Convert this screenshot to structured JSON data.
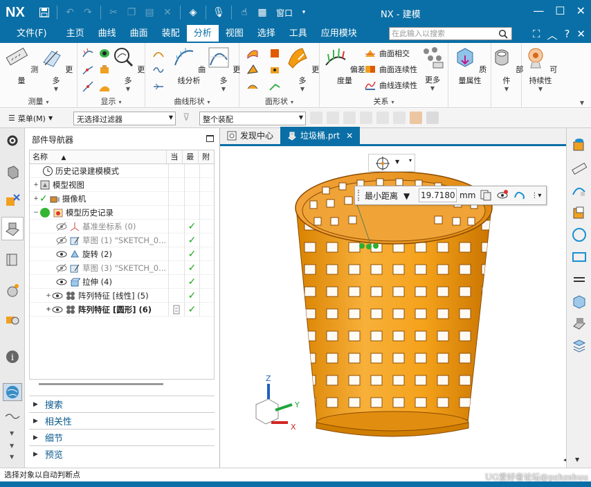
{
  "app": {
    "logo": "NX",
    "title": "NX - 建模",
    "window_menu": "窗口"
  },
  "menubar": {
    "file": "文件(F)",
    "tabs": [
      "主页",
      "曲线",
      "曲面",
      "装配",
      "分析",
      "视图",
      "选择",
      "工具",
      "应用模块"
    ],
    "active_tab": "分析",
    "search_placeholder": "在此输入以搜索"
  },
  "ribbon": {
    "measure_group": {
      "label": "测量",
      "buttons": [
        "测量",
        "更多"
      ]
    },
    "display_group": {
      "label": "显示",
      "buttons": [
        "更多"
      ]
    },
    "curve_shape_group": {
      "label": "曲线形状",
      "buttons": [
        "曲线分析",
        "更多"
      ]
    },
    "face_shape_group": {
      "label": "面形状",
      "buttons": [
        "更多"
      ]
    },
    "relation_group": {
      "label": "关系",
      "big": "偏差度量",
      "small": [
        "曲面相交",
        "曲面连续性",
        "曲线连续性"
      ],
      "more": "更多"
    },
    "mass": "质量属性",
    "part": "部件",
    "sustain": "可持续性"
  },
  "toolbar2": {
    "menu": "菜单(M)",
    "filter": "无选择过滤器",
    "assembly": "整个装配"
  },
  "navigator": {
    "title": "部件导航器",
    "columns": [
      "名称",
      "当",
      "最",
      "附"
    ],
    "rows": [
      {
        "label": "历史记录建模模式",
        "check": false
      },
      {
        "label": "模型视图",
        "check": false
      },
      {
        "label": "摄像机",
        "check": false
      },
      {
        "label": "模型历史记录",
        "check": false
      },
      {
        "label": "基准坐标系 (0)",
        "check": true
      },
      {
        "label": "草图 (1) \"SKETCH_0...",
        "check": true
      },
      {
        "label": "旋转 (2)",
        "check": true
      },
      {
        "label": "草图 (3) \"SKETCH_0...",
        "check": true
      },
      {
        "label": "拉伸 (4)",
        "check": true
      },
      {
        "label": "阵列特征 [线性] (5)",
        "check": true
      },
      {
        "label": "阵列特征 [圆形] (6)",
        "check": true
      }
    ],
    "panels": [
      "搜索",
      "相关性",
      "细节",
      "预览"
    ]
  },
  "graphics": {
    "tabs": [
      "发现中心",
      "垃圾桶.prt"
    ],
    "measure_mode": "最小距离",
    "measure_value": "19.7180",
    "measure_unit": "mm",
    "axis_labels": [
      "Z",
      "Y",
      "X"
    ]
  },
  "status": "选择对象以自动判断点",
  "watermark": "UG爱好者论坛@pzhzshuu",
  "colors": {
    "brand": "#0a6fa6",
    "model": "#f5a21b",
    "check": "#1aa51a"
  }
}
